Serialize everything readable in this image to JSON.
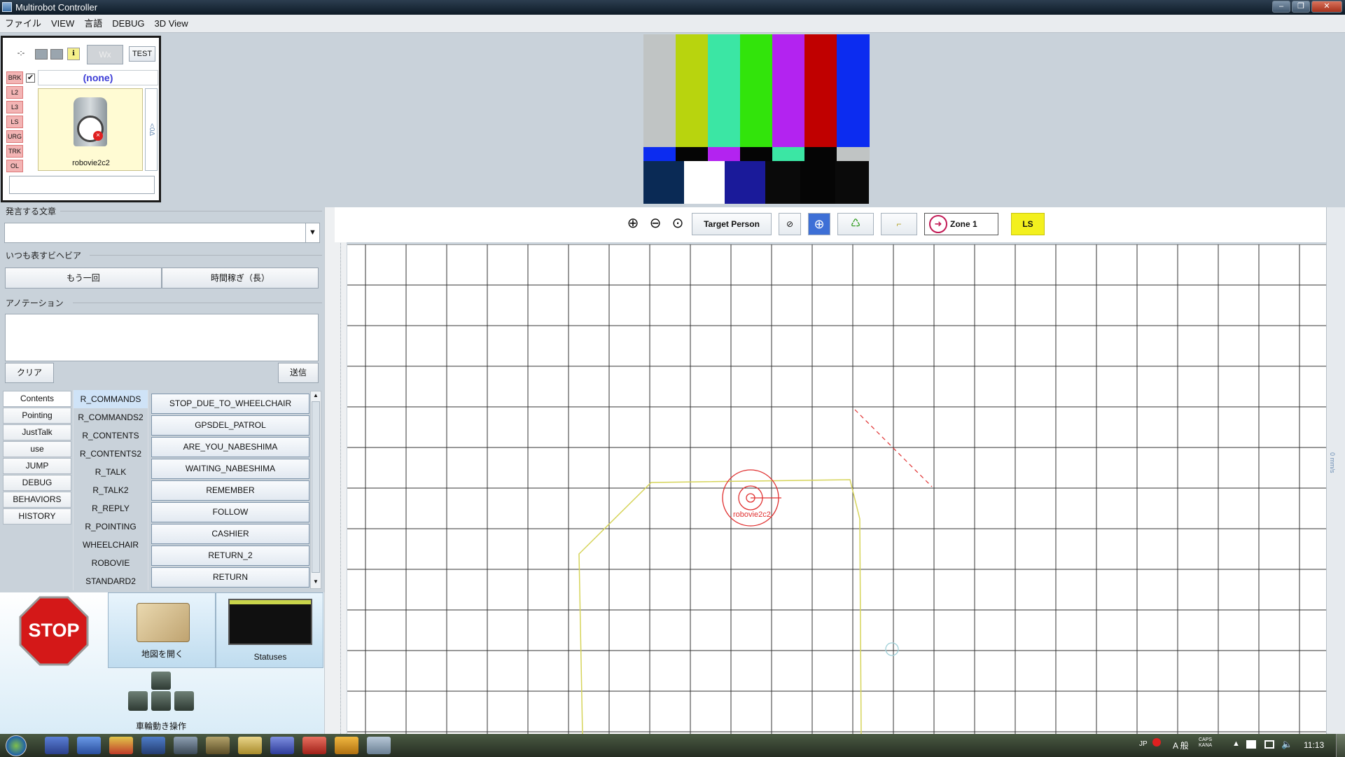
{
  "window": {
    "title": "Multirobot Controller",
    "controls": [
      "–",
      "❐",
      "✕"
    ]
  },
  "menu": [
    "ファイル",
    "VIEW",
    "言語",
    "DEBUG",
    "3D View"
  ],
  "robot_card": {
    "arrow": "-:-",
    "wx_button": "Wx",
    "test_button": "TEST",
    "flags": [
      "BRK",
      "L2",
      "L3",
      "LS",
      "URG",
      "TRK",
      "OL"
    ],
    "selected_text": "(none)",
    "robot_name": "robovie2c2",
    "side_label": "<0Δ",
    "checkbox_checked": true,
    "input_value": ""
  },
  "test_pattern": {
    "top_bars": [
      "#c0c4c4",
      "#b8d40e",
      "#3be6a4",
      "#32e40b",
      "#b323f0",
      "#c00000",
      "#0c2cf0"
    ],
    "mid_bars": [
      "#0c2cf0",
      "#050505",
      "#b323f0",
      "#050505",
      "#3be6a4",
      "#050505",
      "#c0c4c4"
    ],
    "bottom_blocks": [
      "#0a2a55",
      "#ffffff",
      "#1a1a9a",
      "#0a0a0a",
      "#050505",
      "#0a0a0a"
    ]
  },
  "speak": {
    "label": "発言する文章",
    "value": ""
  },
  "behaviors": {
    "label": "いつも表すビヘビア",
    "buttons": [
      "もう一回",
      "時間稼ぎ（長）"
    ]
  },
  "annotation": {
    "label": "アノテーション",
    "value": "",
    "clear": "クリア",
    "send": "送信"
  },
  "tabs": [
    "Contents",
    "Pointing",
    "JustTalk",
    "use",
    "JUMP",
    "DEBUG",
    "BEHAVIORS",
    "HISTORY"
  ],
  "categories": [
    "R_COMMANDS",
    "R_COMMANDS2",
    "R_CONTENTS",
    "R_CONTENTS2",
    "R_TALK",
    "R_TALK2",
    "R_REPLY",
    "R_POINTING",
    "WHEELCHAIR",
    "ROBOVIE",
    "STANDARD2"
  ],
  "commands": [
    "STOP_DUE_TO_WHEELCHAIR",
    "GPSDEL_PATROL",
    "ARE_YOU_NABESHIMA",
    "WAITING_NABESHIMA",
    "REMEMBER",
    "FOLLOW",
    "CASHIER",
    "RETURN_2",
    "RETURN"
  ],
  "bottom": {
    "stop": "STOP",
    "map_open": "地図を開く",
    "statuses": "Statuses",
    "wheel": "車輪動き操作"
  },
  "map_toolbar": {
    "target_person": "Target Person",
    "zone": "Zone 1",
    "ls": "LS"
  },
  "map": {
    "robot_label": "robovie2c2",
    "side_text": "0 mm/s"
  },
  "taskbar": {
    "lang": "JP",
    "ime": "A 般",
    "caps": "CAPS KANA",
    "clock": "11:13"
  }
}
